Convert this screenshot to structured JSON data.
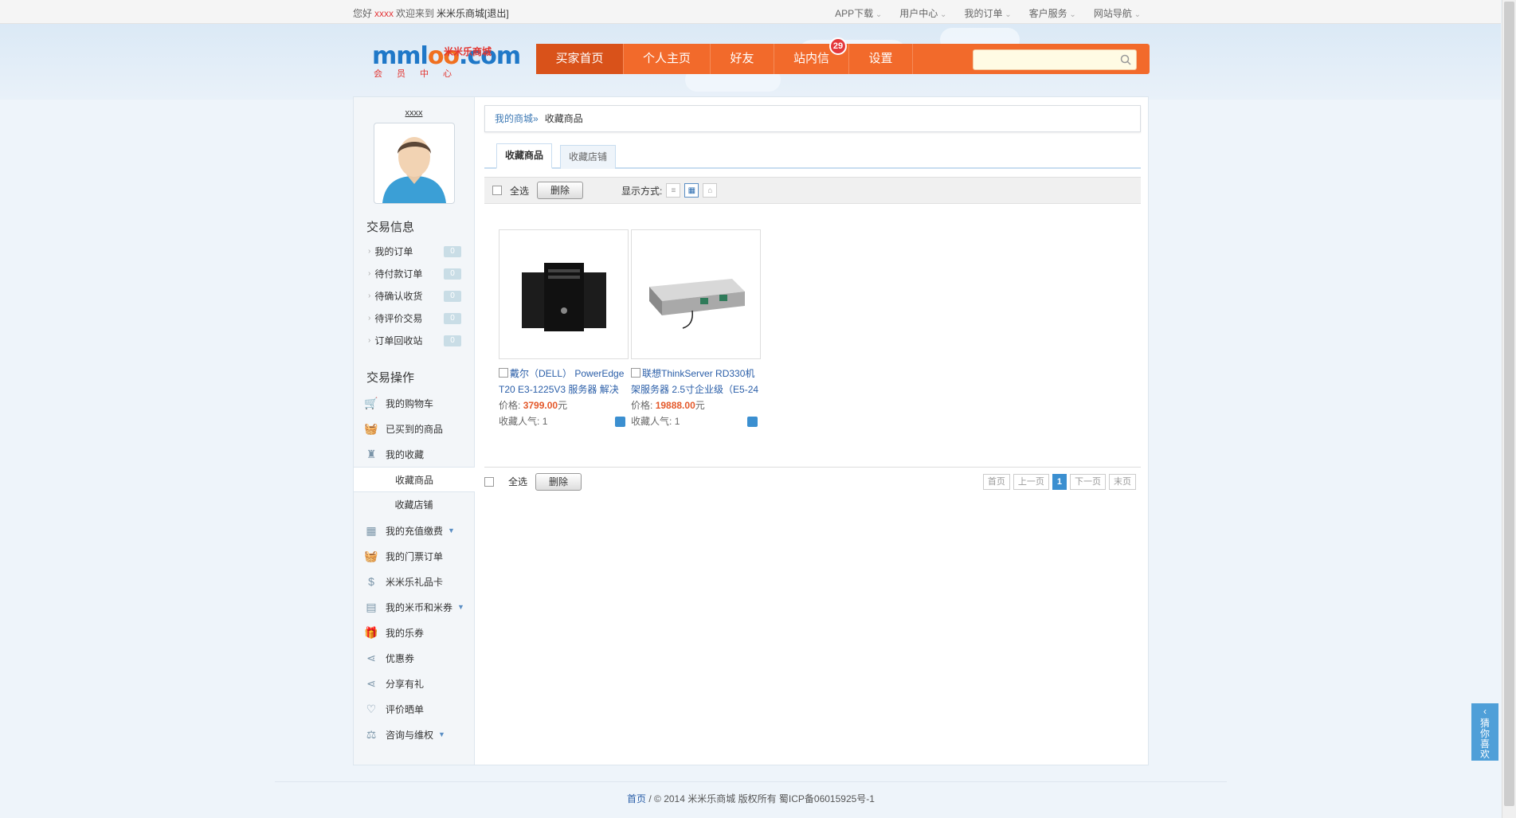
{
  "topbar": {
    "greeting": "您好",
    "username": "xxxx",
    "welcome": "欢迎来到",
    "site": "米米乐商城",
    "logout": "[退出]",
    "nav": [
      "APP下载",
      "用户中心",
      "我的订单",
      "客户服务",
      "网站导航"
    ]
  },
  "logo": {
    "word_a": "mml",
    "word_b": "oo",
    "word_c": ".com",
    "cn": "米米乐商城",
    "sub": "会员中心"
  },
  "mainnav": {
    "tabs": [
      "买家首页",
      "个人主页",
      "好友",
      "站内信",
      "设置"
    ],
    "active": "买家首页",
    "message_count": "29"
  },
  "search": {
    "placeholder": ""
  },
  "sidebar": {
    "username": "xxxx",
    "trade_info_title": "交易信息",
    "trade_items": [
      {
        "label": "我的订单",
        "count": "0"
      },
      {
        "label": "待付款订单",
        "count": "0"
      },
      {
        "label": "待确认收货",
        "count": "0"
      },
      {
        "label": "待评价交易",
        "count": "0"
      },
      {
        "label": "订单回收站",
        "count": "0"
      }
    ],
    "trade_ops_title": "交易操作",
    "ops": {
      "cart": "我的购物车",
      "bought": "已买到的商品",
      "favorites": "我的收藏",
      "fav_goods": "收藏商品",
      "fav_shops": "收藏店铺",
      "recharge": "我的充值缴费",
      "tickets": "我的门票订单",
      "giftcard": "米米乐礼品卡",
      "coins": "我的米币和米券",
      "lequan": "我的乐券",
      "coupons": "优惠券",
      "share": "分享有礼",
      "review": "评价晒单",
      "consult": "咨询与维权"
    }
  },
  "breadcrumb": {
    "link": "我的商城»",
    "current": "收藏商品"
  },
  "tabs": {
    "goods": "收藏商品",
    "shops": "收藏店铺"
  },
  "toolbar": {
    "select_all": "全选",
    "delete": "删除",
    "display_mode": "显示方式:"
  },
  "products": [
    {
      "name": "戴尔（DELL） PowerEdge T20 E3-1225V3 服务器 解决",
      "price_label": "价格:",
      "price": "3799.00",
      "unit": "元",
      "popularity_label": "收藏人气:",
      "popularity": "1"
    },
    {
      "name": "联想ThinkServer RD330机架服务器 2.5寸企业级（E5-24",
      "price_label": "价格:",
      "price": "19888.00",
      "unit": "元",
      "popularity_label": "收藏人气:",
      "popularity": "1"
    }
  ],
  "pager": {
    "first": "首页",
    "prev": "上一页",
    "current": "1",
    "next": "下一页",
    "last": "末页"
  },
  "footer": {
    "home": "首页",
    "text": " / © 2014 米米乐商城 版权所有 蜀ICP备06015925号-1"
  },
  "floatbtn": {
    "arrow": "‹",
    "label": "猜你喜欢"
  },
  "colors": {
    "nav_orange": "#f26a2b",
    "nav_active": "#d9521a",
    "link_blue": "#2a5ea8",
    "price": "#e4592b"
  }
}
